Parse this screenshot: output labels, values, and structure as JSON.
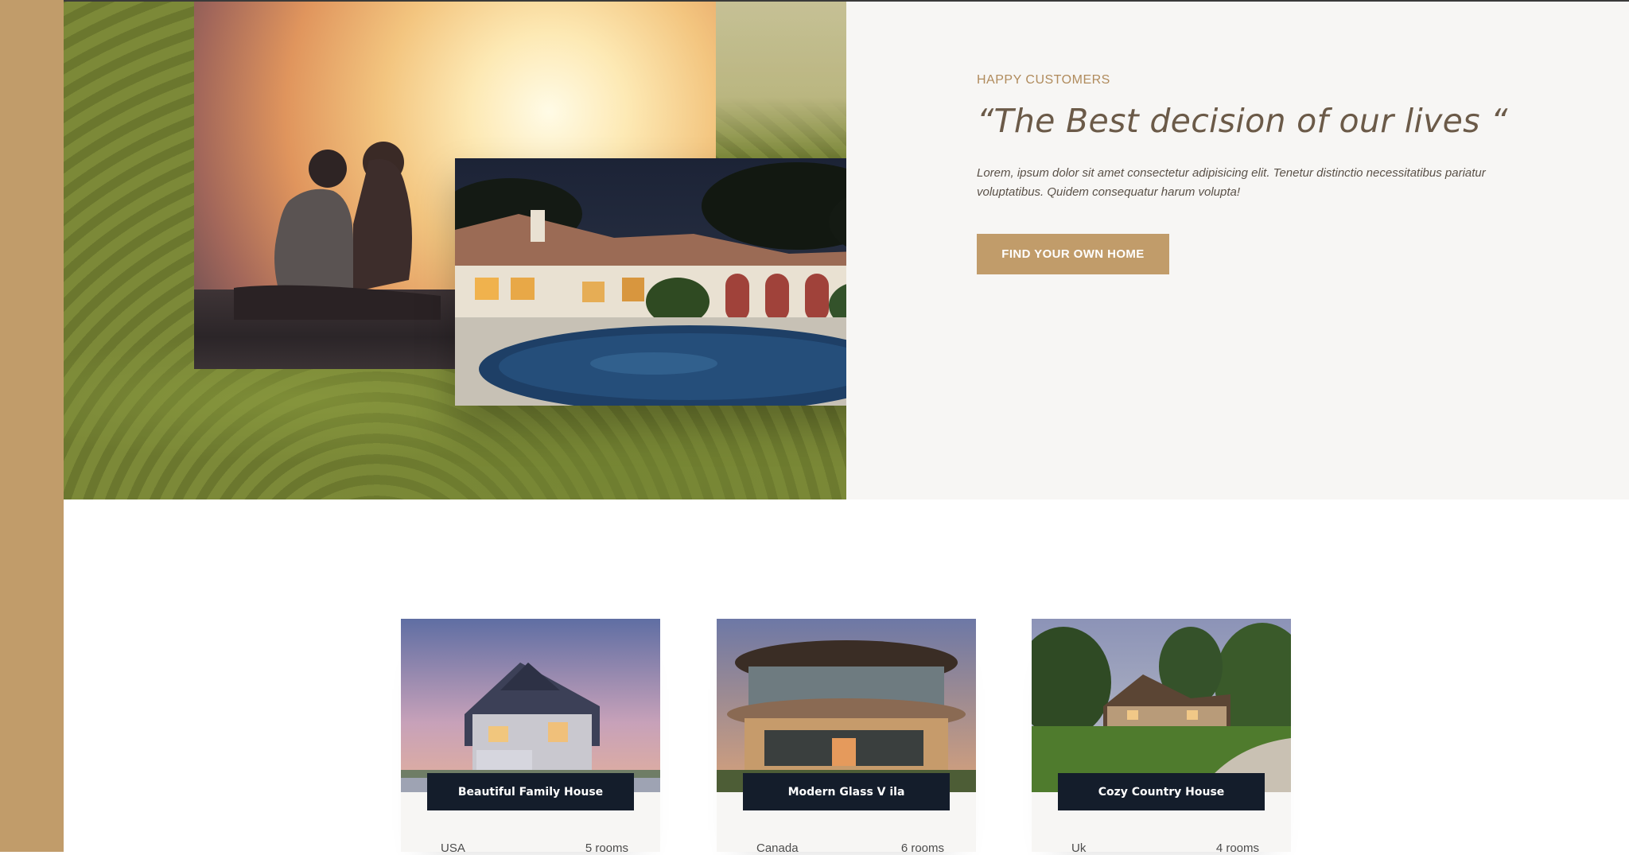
{
  "hero": {
    "eyebrow": "HAPPY CUSTOMERS",
    "quote": "“The Best decision of our lives “",
    "lead": "Lorem, ipsum dolor sit amet consectetur adipisicing elit. Tenetur distinctio necessitatibus pariatur voluptatibus. Quidem consequatur harum volupta!",
    "cta_label": "FIND YOUR OWN HOME"
  },
  "colors": {
    "accent": "#c19c6a",
    "card_title_bg": "#141d2b",
    "panel_bg": "#f7f6f4",
    "quote_text": "#6b5a48"
  },
  "properties": [
    {
      "title": "Beautiful Family House",
      "country": "USA",
      "rooms": "5 rooms"
    },
    {
      "title": "Modern Glass V ila",
      "country": "Canada",
      "rooms": "6 rooms"
    },
    {
      "title": "Cozy Country House",
      "country": "Uk",
      "rooms": "4 rooms"
    }
  ]
}
